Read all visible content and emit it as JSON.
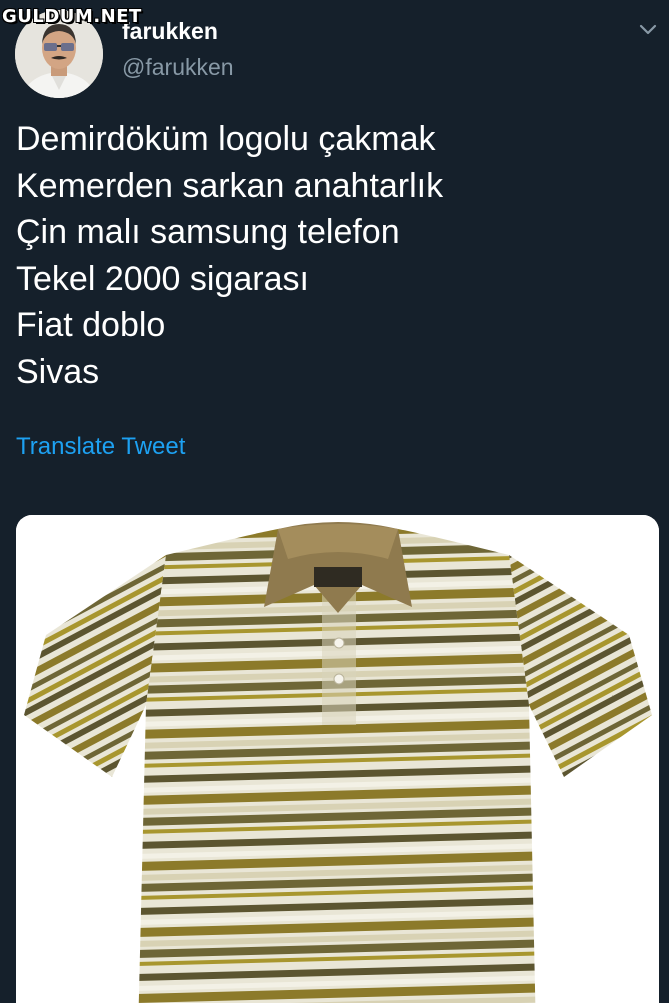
{
  "watermark": "GULDUM.NET",
  "author": {
    "name": "farukken",
    "handle": "@farukken",
    "avatar_icon": "profile-avatar-man-sunglasses"
  },
  "menu_icon": "chevron-down-icon",
  "tweet": {
    "lines": [
      "Demirdöküm logolu çakmak",
      "Kemerden sarkan anahtarlık",
      "Çin malı samsung telefon",
      "Tekel 2000 sigarası",
      "Fiat doblo",
      "Sivas"
    ],
    "translate_label": "Translate Tweet"
  },
  "media": {
    "description_icon": "striped-polo-shirt-image"
  },
  "colors": {
    "background": "#15202b",
    "text": "#ffffff",
    "secondary_text": "#8899a6",
    "link": "#1da1f2"
  }
}
